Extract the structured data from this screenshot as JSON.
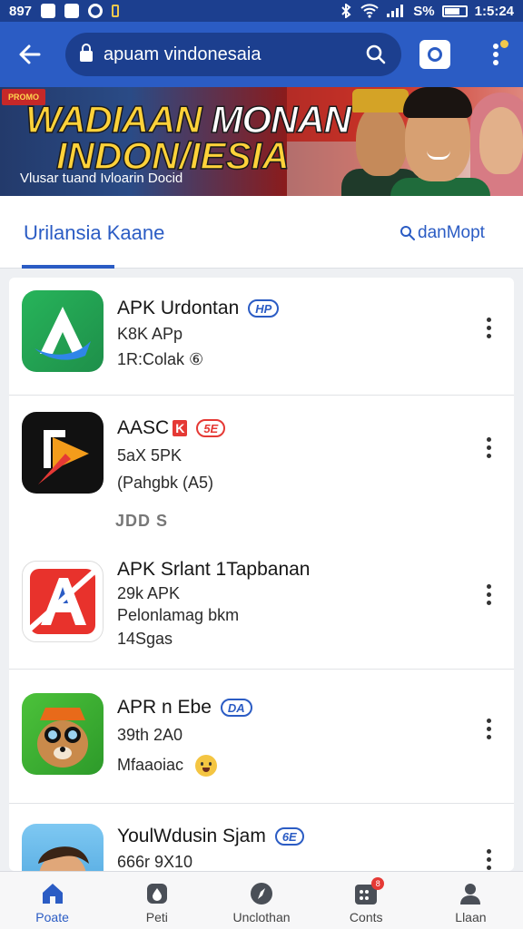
{
  "status_bar": {
    "left_text": "897",
    "battery": "S%",
    "time": "1:5:24"
  },
  "app_bar": {
    "search_query": "apuam vindonesaia",
    "icons": [
      "back-arrow-icon",
      "lock-icon",
      "search-icon",
      "camera-icon",
      "more-vert-icon"
    ]
  },
  "banner": {
    "chip": "PROMO",
    "title_line1_a": "WADIAAN",
    "title_line1_b": "MONAN",
    "title_line2": "INDON/IESIA",
    "caption": "Vlusar tuand Ivloarin Docid"
  },
  "tabs": {
    "main_label": "Urilansia Kaane",
    "right_label": "danMopt"
  },
  "list": {
    "items": [
      {
        "title": "APK Urdontan",
        "pill": "HP",
        "line2": "K8K APp",
        "line3": "1R:Colak ⑥",
        "icon": "blue-arrow-app-icon"
      },
      {
        "title": "AASC",
        "redbox": "K",
        "pill": "5E",
        "line2": "5aX 5PK",
        "line3": "(Pahgbk (A5)",
        "icon": "play-triangle-app-icon"
      }
    ],
    "section_label": "JDD S",
    "items2": [
      {
        "title": "APK Srlant 1Tapbanan",
        "line2": "29k APK",
        "line3": "Pelonlamag bkm",
        "line4": "14Sgas",
        "icon": "red-letter-a-app-icon"
      },
      {
        "title": "APR n Ebe",
        "pill": "DA",
        "line2": "39th 2A0",
        "line3": "Mfaaoiac",
        "icon": "fox-mascot-app-icon"
      },
      {
        "title": "YoulWdusin Sjam",
        "pill": "6E",
        "line2": "666r 9X10",
        "icon": "boy-avatar-app-icon"
      }
    ]
  },
  "bottom_nav": [
    {
      "label": "Poate",
      "icon": "home-icon",
      "active": true
    },
    {
      "label": "Peti",
      "icon": "drop-icon",
      "active": false
    },
    {
      "label": "Unclothan",
      "icon": "compass-icon",
      "active": false
    },
    {
      "label": "Conts",
      "icon": "grid-badge-icon",
      "active": false,
      "badge": "8"
    },
    {
      "label": "Llaan",
      "icon": "person-icon",
      "active": false
    }
  ]
}
